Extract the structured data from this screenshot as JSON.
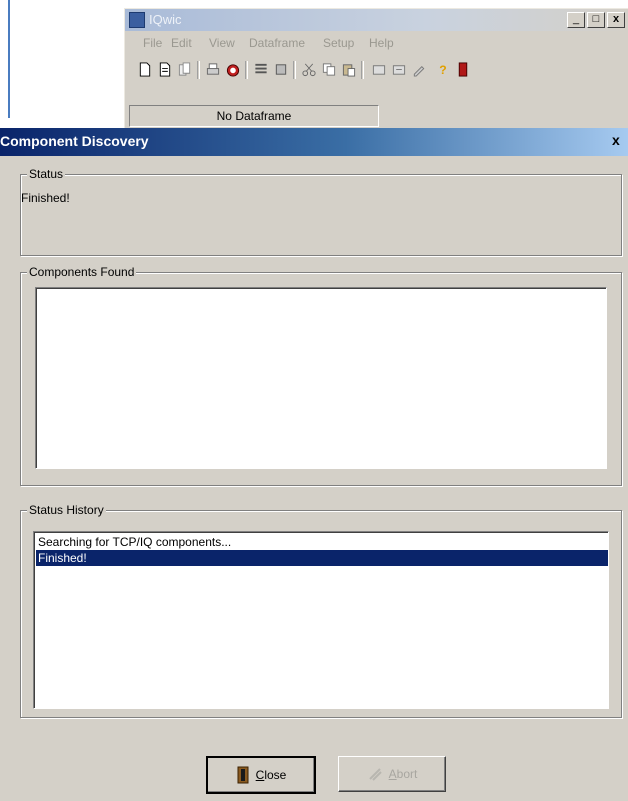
{
  "bg_window": {
    "title": "IQwic",
    "min_glyph": "_",
    "max_glyph": "□",
    "close_glyph": "x",
    "menu": [
      "File",
      "Edit",
      "View",
      "Dataframe",
      "Setup",
      "Help"
    ],
    "dataframe_label": "No Dataframe"
  },
  "dialog": {
    "title": "Component Discovery",
    "close_glyph": "x",
    "status": {
      "label": "Status",
      "text": "Finished!"
    },
    "components": {
      "label": "Components Found"
    },
    "history": {
      "label": "Status History",
      "rows": [
        "Searching for TCP/IQ components...",
        "Finished!"
      ]
    },
    "buttons": {
      "close_mnemonic": "C",
      "close_rest": "lose",
      "abort_mnemonic": "A",
      "abort_rest": "bort"
    }
  },
  "colors": {
    "selection": "#0a246a",
    "titlebar": "#0a246a",
    "face": "#d4d0c8"
  }
}
